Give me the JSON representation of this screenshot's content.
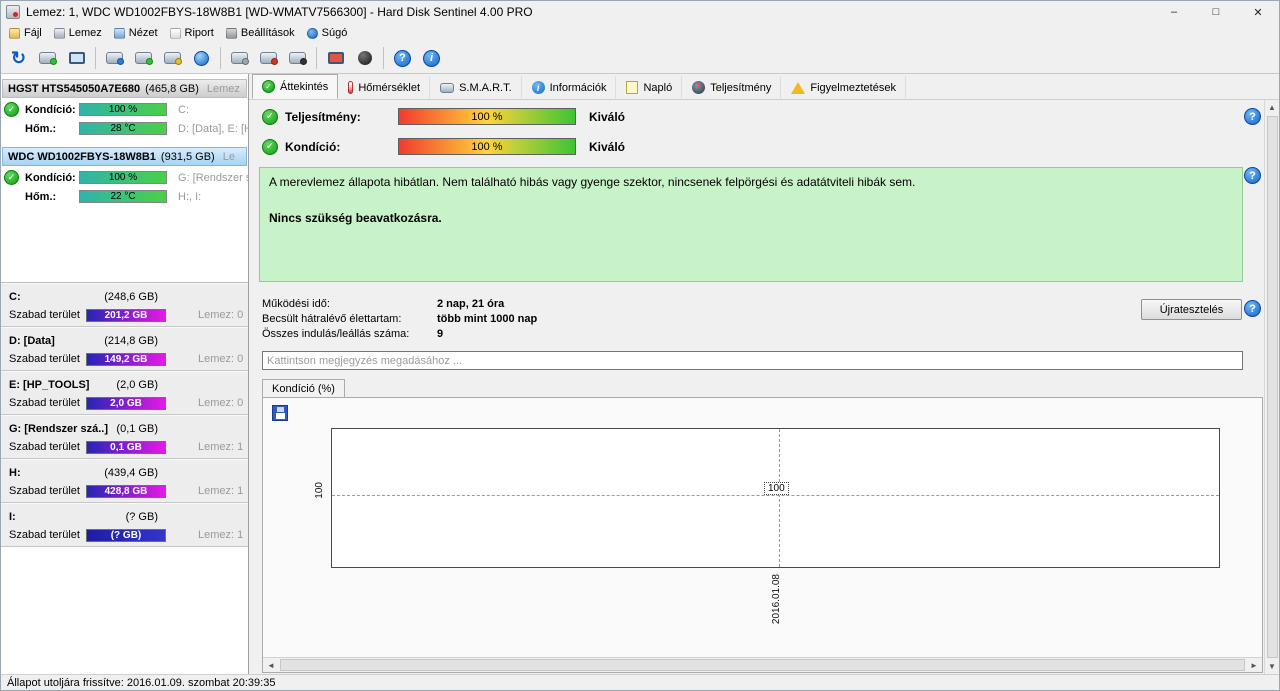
{
  "window": {
    "title": "Lemez: 1, WDC WD1002FBYS-18W8B1 [WD-WMATV7566300] - Hard Disk Sentinel 4.00 PRO",
    "controls": {
      "minimize": "–",
      "maximize": "□",
      "close": "✕"
    }
  },
  "menu": {
    "items": [
      {
        "label": "Fájl"
      },
      {
        "label": "Lemez"
      },
      {
        "label": "Nézet"
      },
      {
        "label": "Riport"
      },
      {
        "label": "Beállítások"
      },
      {
        "label": "Súgó"
      }
    ]
  },
  "toolbar": {
    "icons": [
      "refresh-icon",
      "disk-stack-icon",
      "monitor-disk-icon",
      "disk-search-icon",
      "disk-sync-icon",
      "disk-clone-icon",
      "world-icon",
      "disk-eject-icon",
      "disk-write-icon",
      "disk-delete-icon",
      "surface-test-icon",
      "shutdown-icon",
      "help-icon",
      "info-icon"
    ]
  },
  "sidebar": {
    "disks": [
      {
        "name": "HGST HTS545050A7E680",
        "size": "(465,8 GB)",
        "trailing": "Lemez",
        "condition_label": "Kondíció:",
        "condition_value": "100 %",
        "condition_extra": "C:",
        "temp_label": "Hőm.:",
        "temp_value": "28 °C",
        "temp_extra": "D: [Data], E: [H"
      },
      {
        "name": "WDC WD1002FBYS-18W8B1",
        "size": "(931,5 GB)",
        "trailing": "Le",
        "condition_label": "Kondíció:",
        "condition_value": "100 %",
        "condition_extra": "G: [Rendszer s",
        "temp_label": "Hőm.:",
        "temp_value": "22 °C",
        "temp_extra": "H:, I:"
      }
    ],
    "partitions": [
      {
        "name": "C:",
        "size": "(248,6 GB)",
        "free_label": "Szabad terület",
        "free_value": "201,2 GB",
        "disk": "Lemez: 0"
      },
      {
        "name": "D: [Data]",
        "size": "(214,8 GB)",
        "free_label": "Szabad terület",
        "free_value": "149,2 GB",
        "disk": "Lemez: 0"
      },
      {
        "name": "E: [HP_TOOLS]",
        "size": "(2,0 GB)",
        "free_label": "Szabad terület",
        "free_value": "2,0 GB",
        "disk": "Lemez: 0"
      },
      {
        "name": "G: [Rendszer szá..]",
        "size": "(0,1 GB)",
        "free_label": "Szabad terület",
        "free_value": "0,1 GB",
        "disk": "Lemez: 1"
      },
      {
        "name": "H:",
        "size": "(439,4 GB)",
        "free_label": "Szabad terület",
        "free_value": "428,8 GB",
        "disk": "Lemez: 1"
      },
      {
        "name": "I:",
        "size": "(? GB)",
        "free_label": "Szabad terület",
        "free_value": "(? GB)",
        "disk": "Lemez: 1"
      }
    ]
  },
  "tabs": [
    {
      "label": "Áttekintés"
    },
    {
      "label": "Hőmérséklet"
    },
    {
      "label": "S.M.A.R.T."
    },
    {
      "label": "Információk"
    },
    {
      "label": "Napló"
    },
    {
      "label": "Teljesítmény"
    },
    {
      "label": "Figyelmeztetések"
    }
  ],
  "overview": {
    "performance_label": "Teljesítmény:",
    "performance_value": "100 %",
    "performance_rating": "Kiváló",
    "condition_label": "Kondíció:",
    "condition_value": "100 %",
    "condition_rating": "Kiváló",
    "status_text_1": "A merevlemez állapota hibátlan. Nem található hibás vagy gyenge szektor, nincsenek felpörgési és adatátviteli hibák sem.",
    "status_text_2": "Nincs szükség beavatkozásra.",
    "stats": [
      {
        "label": "Működési idő:",
        "value": "2 nap, 21 óra"
      },
      {
        "label": "Becsült hátralévő élettartam:",
        "value": "több mint 1000 nap"
      },
      {
        "label": "Összes indulás/leállás száma:",
        "value": "9"
      }
    ],
    "retest_button": "Újratesztelés",
    "comment_placeholder": "Kattintson megjegyzés megadásához ..."
  },
  "chart": {
    "tab_label": "Kondíció  (%)",
    "ytick": "100",
    "point_label": "100",
    "xtick": "2016.01.08"
  },
  "chart_data": {
    "type": "line",
    "title": "Kondíció (%)",
    "x": [
      "2016.01.08"
    ],
    "series": [
      {
        "name": "Kondíció",
        "values": [
          100
        ]
      }
    ],
    "yticks": [
      100
    ],
    "grid": "dashed",
    "legend_position": "none"
  },
  "statusbar": {
    "text": "Állapot utoljára frissítve: 2016.01.09. szombat 20:39:35"
  },
  "accent_colors": {
    "condition_bar": "#3cc435",
    "free_space_bar": "#e619e6",
    "status_box_bg": "#c8f3c8",
    "selected_disk_bg": "#a5d3f3"
  }
}
